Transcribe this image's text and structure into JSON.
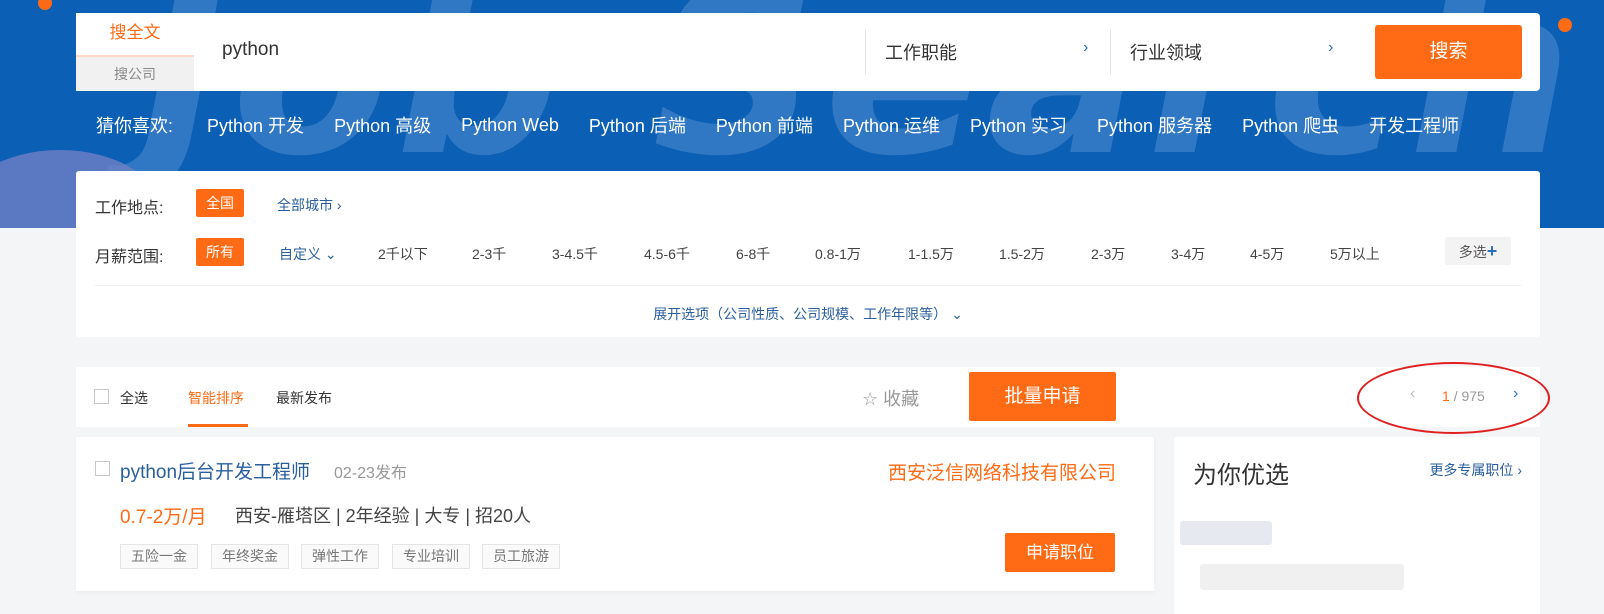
{
  "search": {
    "tab_full": "搜全文",
    "tab_company": "搜公司",
    "query": "python",
    "job_function": "工作职能",
    "industry": "行业领域",
    "button": "搜索"
  },
  "guess": {
    "label": "猜你喜欢:",
    "items": [
      "Python 开发",
      "Python 高级",
      "Python Web",
      "Python 后端",
      "Python 前端",
      "Python 运维",
      "Python 实习",
      "Python 服务器",
      "Python 爬虫",
      "开发工程师"
    ]
  },
  "filters": {
    "location_label": "工作地点:",
    "location_selected": "全国",
    "all_cities": "全部城市",
    "salary_label": "月薪范围:",
    "salary_selected": "所有",
    "custom": "自定义",
    "salary_options": [
      "2千以下",
      "2-3千",
      "3-4.5千",
      "4.5-6千",
      "6-8千",
      "0.8-1万",
      "1-1.5万",
      "1.5-2万",
      "2-3万",
      "3-4万",
      "4-5万",
      "5万以上"
    ],
    "multi": "多选",
    "expand": "展开选项（公司性质、公司规模、工作年限等）"
  },
  "toolbar": {
    "select_all": "全选",
    "sort_smart": "智能排序",
    "sort_latest": "最新发布",
    "favorite": "收藏",
    "batch_apply": "批量申请",
    "page_current": "1",
    "page_total": "/ 975"
  },
  "job": {
    "title": "python后台开发工程师",
    "date": "02-23发布",
    "company": "西安泛信网络科技有限公司",
    "salary": "0.7-2万/月",
    "info": "西安-雁塔区 | 2年经验 | 大专 | 招20人",
    "tags": [
      "五险一金",
      "年终奖金",
      "弹性工作",
      "专业培训",
      "员工旅游"
    ],
    "apply": "申请职位"
  },
  "sidebar": {
    "title": "为你优选",
    "more": "更多专属职位"
  },
  "colors": {
    "accent": "#ff6a14",
    "hero": "#0b5fb4",
    "link": "#2a5f9e"
  }
}
